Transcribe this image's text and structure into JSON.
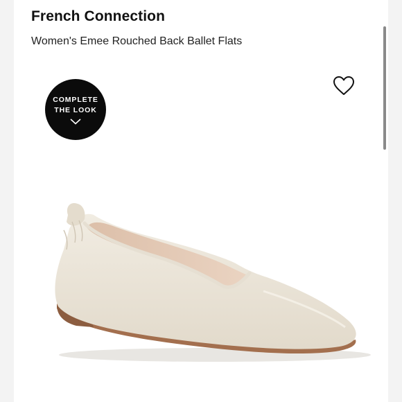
{
  "product": {
    "brand": "French Connection",
    "name": "Women's Emee Rouched Back Ballet Flats"
  },
  "badge": {
    "line1": "COMPLETE",
    "line2": "THE LOOK",
    "icon": "chevron-down-icon"
  },
  "actions": {
    "favorite_icon": "heart-icon"
  },
  "colors": {
    "badge_bg": "#0b0b0b",
    "shoe": "#ece6da",
    "lining": "#e8c9b2",
    "sole": "#a36f4e"
  }
}
